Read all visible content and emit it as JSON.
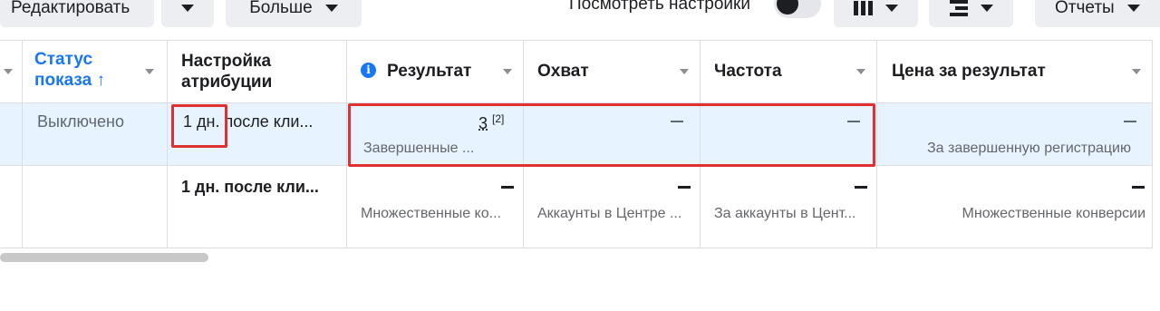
{
  "toolbar": {
    "edit_label": "Редактировать",
    "more_label": "Больше",
    "view_settings_label": "Посмотреть настройки",
    "reports_label": "Отчеты"
  },
  "columns": {
    "status": "Статус показа",
    "status_arrow": "↑",
    "attribution_line1": "Настройка",
    "attribution_line2": "атрибуции",
    "result": "Результат",
    "reach": "Охват",
    "frequency": "Частота",
    "cost": "Цена за результат"
  },
  "row1": {
    "status": "Выключено",
    "attribution_a": "1 дн.",
    "attribution_b": " после кли...",
    "result_value": "3",
    "result_note": "[2]",
    "result_sub": "Завершенные ...",
    "reach_value": "—",
    "frequency_value": "—",
    "cost_value": "—",
    "cost_sub": "За завершенную регистрацию"
  },
  "row2": {
    "attribution": "1 дн. после кли...",
    "result_sub": "Множественные ко...",
    "reach_sub": "Аккаунты в Центре ...",
    "frequency_sub": "За аккаунты в Цент...",
    "cost_sub": "Множественные конверсии"
  },
  "colors": {
    "accent": "#1877f2",
    "highlight_row": "#e7f3ff",
    "annotation_red": "#e0302f"
  },
  "icons": [
    "chevron-down-icon",
    "toggle-switch",
    "columns-icon",
    "breakdown-icon",
    "info-icon",
    "sort-arrow-icon"
  ]
}
